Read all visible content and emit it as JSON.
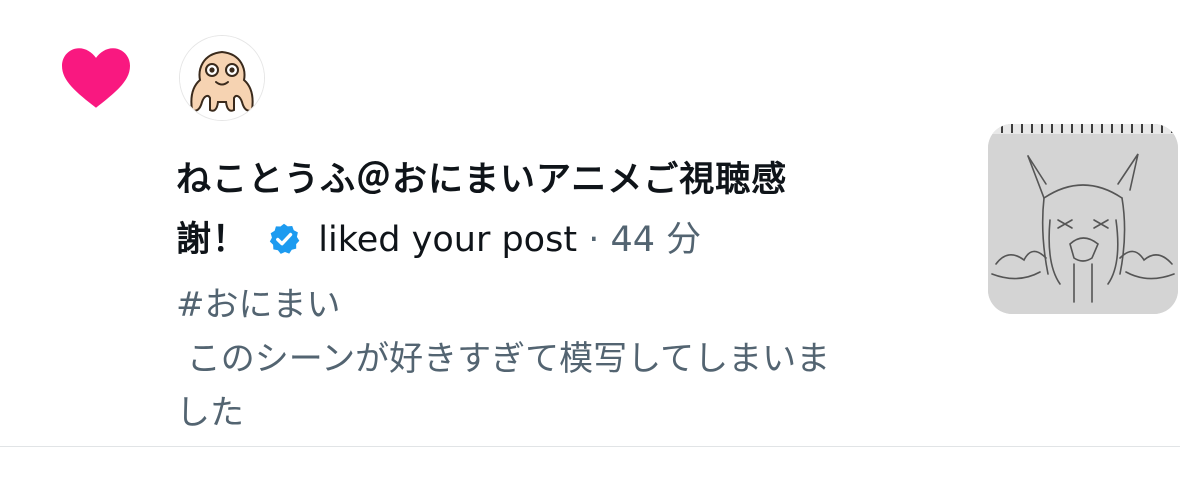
{
  "notification": {
    "user_name_line1": "ねことうふ＠おにまいアニメご視聴感",
    "user_name_line2": "謝！",
    "action_text": "liked your post",
    "separator": "·",
    "time_ago": "44 分",
    "post_line1": "#おにまい",
    "post_line2": " このシーンが好きすぎて模写してしまいま",
    "post_line3": "した",
    "icons": {
      "like": "heart-icon",
      "verified": "verified-badge-icon"
    },
    "colors": {
      "heart": "#f91880",
      "verified": "#1d9bf0",
      "text_primary": "#0f1419",
      "text_secondary": "#536471"
    }
  }
}
